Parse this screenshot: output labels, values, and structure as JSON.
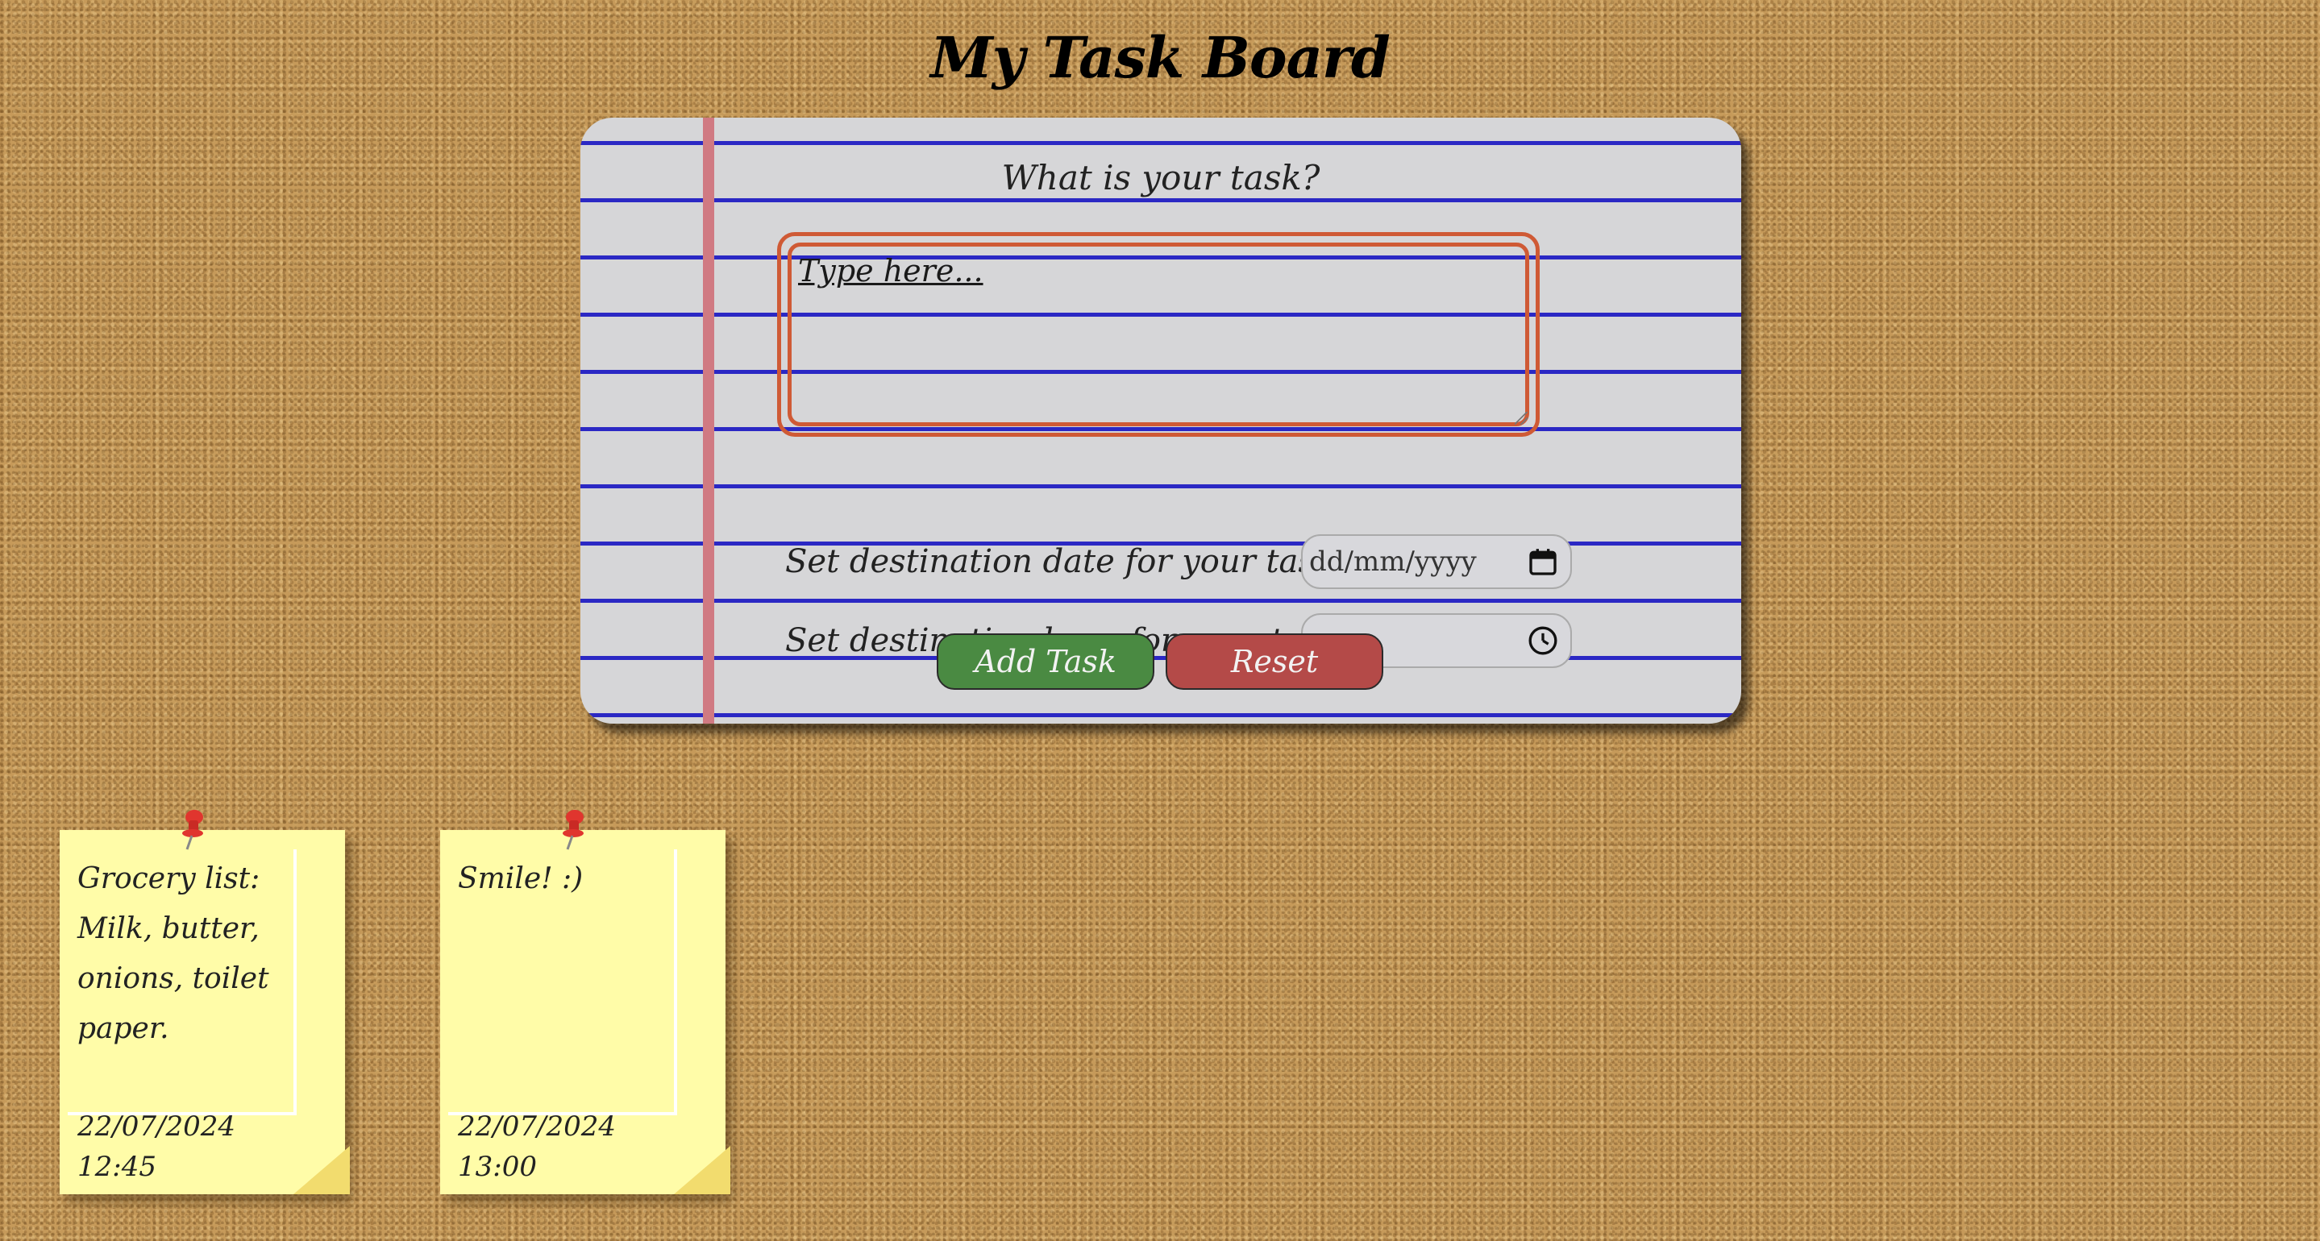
{
  "page": {
    "title": "My Task Board"
  },
  "form": {
    "question": "What is your task?",
    "task_placeholder": "Type here...",
    "date_label": "Set destination date for your task:",
    "date_placeholder": "dd/mm/yyyy",
    "date_icon": "calendar-icon",
    "time_label": "Set destination hour for your task:",
    "time_placeholder": "--:--",
    "time_icon": "clock-icon",
    "add_button": "Add Task",
    "reset_button": "Reset"
  },
  "colors": {
    "add_button": "#4a8a42",
    "reset_button": "#b44a48",
    "textarea_border": "#cf5a35",
    "ruled_lines": "#2b28c4",
    "margin_line": "#d07a82",
    "sticky_note": "#fffca8"
  },
  "notes": [
    {
      "text": "Grocery list: Milk, butter, onions, toilet paper.",
      "date": "22/07/2024",
      "time": "12:45",
      "pin_icon": "pushpin-icon"
    },
    {
      "text": "Smile! :)",
      "date": "22/07/2024",
      "time": "13:00",
      "pin_icon": "pushpin-icon"
    }
  ]
}
